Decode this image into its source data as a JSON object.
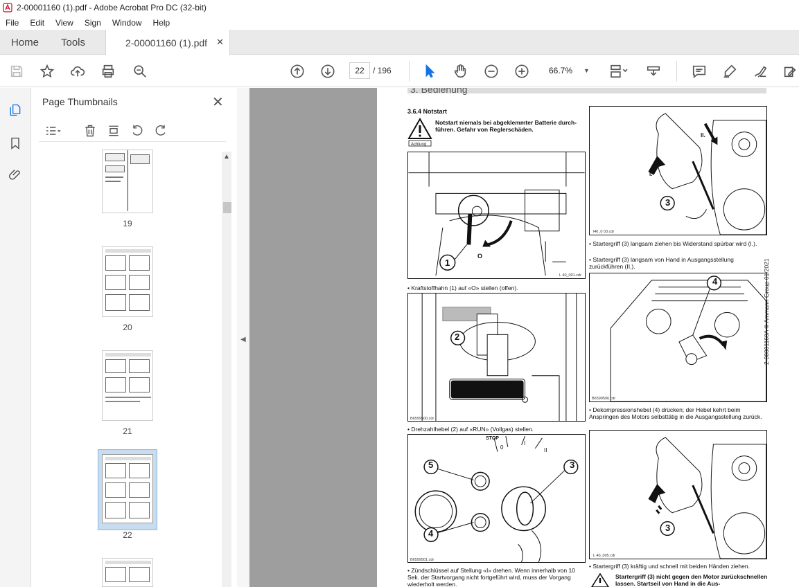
{
  "window": {
    "title": "2-00001160 (1).pdf - Adobe Acrobat Pro DC (32-bit)"
  },
  "menu": [
    "File",
    "Edit",
    "View",
    "Sign",
    "Window",
    "Help"
  ],
  "tabs": {
    "home": "Home",
    "tools": "Tools",
    "document": "2-00001160 (1).pdf"
  },
  "toolbar": {
    "current_page": "22",
    "page_count": "/ 196",
    "zoom": "66.7%"
  },
  "thumbnails": {
    "title": "Page Thumbnails",
    "pages": [
      {
        "label": "19"
      },
      {
        "label": "20"
      },
      {
        "label": "21"
      },
      {
        "label": "22",
        "selected": true
      }
    ]
  },
  "document": {
    "section_header": "3. Bedienung",
    "section": "3.6.4    Notstart",
    "warning_text": "Notstart niemals bei abgeklemmter Batterie durch-führen. Gefahr von Reglerschäden.",
    "warning_label": "Achtung",
    "fig1_id": "L 40_001.cdr",
    "step1": "Kraftstoffhahn (1) auf «O» stellen (offen).",
    "fig2_id": "B6599500.cdr",
    "step2": "Drehzahlhebel (2) auf «RUN» (Vollgas) stellen.",
    "fig3_id": "B6599501.cdr",
    "step3": "Zündschlüssel auf Stellung «I» drehen. Wenn innerhalb von 10 Sek. der Startvorgang nicht fortgeführt wird, muss der Vorgang wiederholt werden.",
    "fig4_id": "l40_0 03.cdr",
    "step4a": "Startergriff (3) langsam ziehen bis Widerstand spürbar wird (I.).",
    "step4b": "Startergriff (3) langsam von Hand in Ausgangsstellung zurückführen (II.).",
    "fig5_id": "B6599506.cdr",
    "step5": "Dekompressionshebel (4) drücken; der Hebel kehrt beim Anspringen des Motors selbsttätig in die Ausgangsstellung zurück.",
    "fig6_id": "L 40_005.cdr",
    "step6": "Startergriff (3) kräftig und schnell mit beiden Händen ziehen.",
    "warning2": "Startergriff (3) nicht gegen den Motor zurückschnellen lassen. Startseil von Hand in die Aus-",
    "side_text": "2-00001160A © Ammann Group  01/2021",
    "callouts": {
      "c1": "1",
      "c2": "2",
      "c3": "3",
      "c4": "4",
      "c5": "5",
      "I": "I.",
      "II": "II.",
      "O": "O",
      "stop": "STOP",
      "pos0": "0",
      "posI": "I",
      "posII": "II"
    }
  }
}
